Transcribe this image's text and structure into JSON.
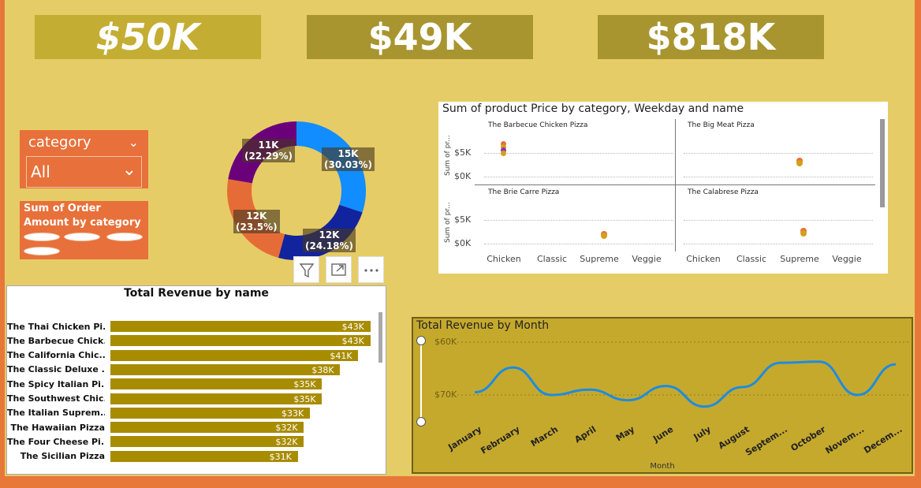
{
  "kpis": [
    "$50K",
    "$49K",
    "$818K"
  ],
  "slicer": {
    "title": "category",
    "value": "All"
  },
  "legend": {
    "title": "Sum of Order Amount by category"
  },
  "donut": {
    "segments": [
      {
        "value_label": "15K",
        "pct_label": "(30.03%)",
        "color": "#118dff"
      },
      {
        "value_label": "12K",
        "pct_label": "(24.18%)",
        "color": "#12239e"
      },
      {
        "value_label": "12K",
        "pct_label": "(23.5%)",
        "color": "#e66c37"
      },
      {
        "value_label": "11K",
        "pct_label": "(22.29%)",
        "color": "#6b007b"
      }
    ]
  },
  "revenue_by_name": {
    "title": "Total Revenue by name",
    "rows": [
      {
        "name": "The Thai Chicken Pi...",
        "value": "$43K"
      },
      {
        "name": "The Barbecue Chick...",
        "value": "$43K"
      },
      {
        "name": "The California Chic...",
        "value": "$41K"
      },
      {
        "name": "The Classic Deluxe ...",
        "value": "$38K"
      },
      {
        "name": "The Spicy Italian Pi...",
        "value": "$35K"
      },
      {
        "name": "The Southwest Chic...",
        "value": "$35K"
      },
      {
        "name": "The Italian Suprem...",
        "value": "$33K"
      },
      {
        "name": "The Hawaiian Pizza",
        "value": "$32K"
      },
      {
        "name": "The Four Cheese Pi...",
        "value": "$32K"
      },
      {
        "name": "The Sicilian Pizza",
        "value": "$31K"
      }
    ]
  },
  "product_price": {
    "title": "Sum of product Price by category, Weekday and name",
    "panels": [
      "The Barbecue Chicken Pizza",
      "The Big Meat Pizza",
      "The Brie Carre Pizza",
      "The Calabrese Pizza"
    ],
    "y_label": "Sum of pr...",
    "y_ticks": [
      "$5K",
      "$0K"
    ],
    "x_categories": [
      "Chicken",
      "Classic",
      "Supreme",
      "Veggie"
    ]
  },
  "revenue_by_month": {
    "title": "Total Revenue by Month",
    "y_ticks": [
      "$60K",
      "$70K"
    ],
    "x_title": "Month",
    "months": [
      "January",
      "February",
      "March",
      "April",
      "May",
      "June",
      "July",
      "August",
      "Septem...",
      "October",
      "Novem...",
      "Decem..."
    ]
  },
  "chart_data": [
    {
      "type": "pie",
      "title": "Sum of Order Amount by category",
      "labels": [
        "15K",
        "12K",
        "12K",
        "11K"
      ],
      "values": [
        30.03,
        24.18,
        23.5,
        22.29
      ]
    },
    {
      "type": "bar",
      "title": "Total Revenue by name",
      "categories": [
        "The Thai Chicken Pi...",
        "The Barbecue Chick...",
        "The California Chic...",
        "The Classic Deluxe ...",
        "The Spicy Italian Pi...",
        "The Southwest Chic...",
        "The Italian Suprem...",
        "The Hawaiian Pizza",
        "The Four Cheese Pi...",
        "The Sicilian Pizza"
      ],
      "values": [
        43,
        43,
        41,
        38,
        35,
        35,
        33,
        32,
        32,
        31
      ]
    },
    {
      "type": "line",
      "title": "Total Revenue by Month",
      "xlabel": "Month",
      "categories": [
        "January",
        "February",
        "March",
        "April",
        "May",
        "June",
        "July",
        "August",
        "Septem...",
        "October",
        "Novem...",
        "Decem..."
      ],
      "values": [
        69.5,
        64.8,
        70.0,
        69.0,
        71.0,
        68.3,
        72.2,
        68.5,
        63.9,
        63.7,
        70.0,
        64.2
      ],
      "ylim": [
        60,
        72.5
      ]
    }
  ]
}
